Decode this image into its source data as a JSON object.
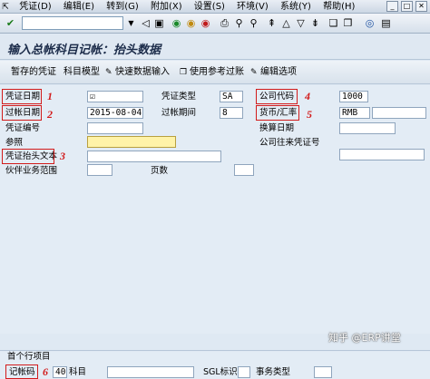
{
  "menubar": {
    "items": [
      "凭证(D)",
      "编辑(E)",
      "转到(G)",
      "附加(X)",
      "设置(S)",
      "环境(V)",
      "系统(Y)",
      "帮助(H)"
    ]
  },
  "toolbar": {
    "command_value": ""
  },
  "title": "输入总帐科目记帐：抬头数据",
  "app_toolbar": {
    "items": [
      "暂存的凭证",
      "科目模型",
      "快速数据输入",
      "使用参考过账",
      "编辑选项"
    ]
  },
  "header": {
    "doc_date": {
      "label": "凭证日期",
      "value": "☑"
    },
    "posting_date": {
      "label": "过帐日期",
      "value": "2015-08-04"
    },
    "doc_number": {
      "label": "凭证编号",
      "value": ""
    },
    "reference": {
      "label": "参照",
      "value": ""
    },
    "header_text": {
      "label": "凭证抬头文本",
      "value": ""
    },
    "trading_partner": {
      "label": "伙伴业务范围",
      "value": ""
    },
    "doc_type": {
      "label": "凭证类型",
      "value": "SA"
    },
    "period": {
      "label": "过帐期间",
      "value": "8"
    },
    "page": {
      "label": "页数",
      "value": ""
    },
    "company_code": {
      "label": "公司代码",
      "value": "1000"
    },
    "currency": {
      "label": "货币/汇率",
      "value": "RMB",
      "rate": ""
    },
    "translation_date": {
      "label": "换算日期",
      "value": ""
    },
    "intercompany": {
      "label": "公司往来凭证号",
      "value": ""
    }
  },
  "first_line": {
    "section_title": "首个行项目",
    "posting_key_label": "记帐码",
    "posting_key_value": "40",
    "account_label": "科目",
    "account_value": "",
    "sgl_label": "SGL标识",
    "sgl_value": "",
    "trans_type_label": "事务类型",
    "trans_type_value": ""
  },
  "annotations": [
    "1",
    "2",
    "3",
    "4",
    "5",
    "6"
  ],
  "watermark": "知乎 @ERP讲堂"
}
